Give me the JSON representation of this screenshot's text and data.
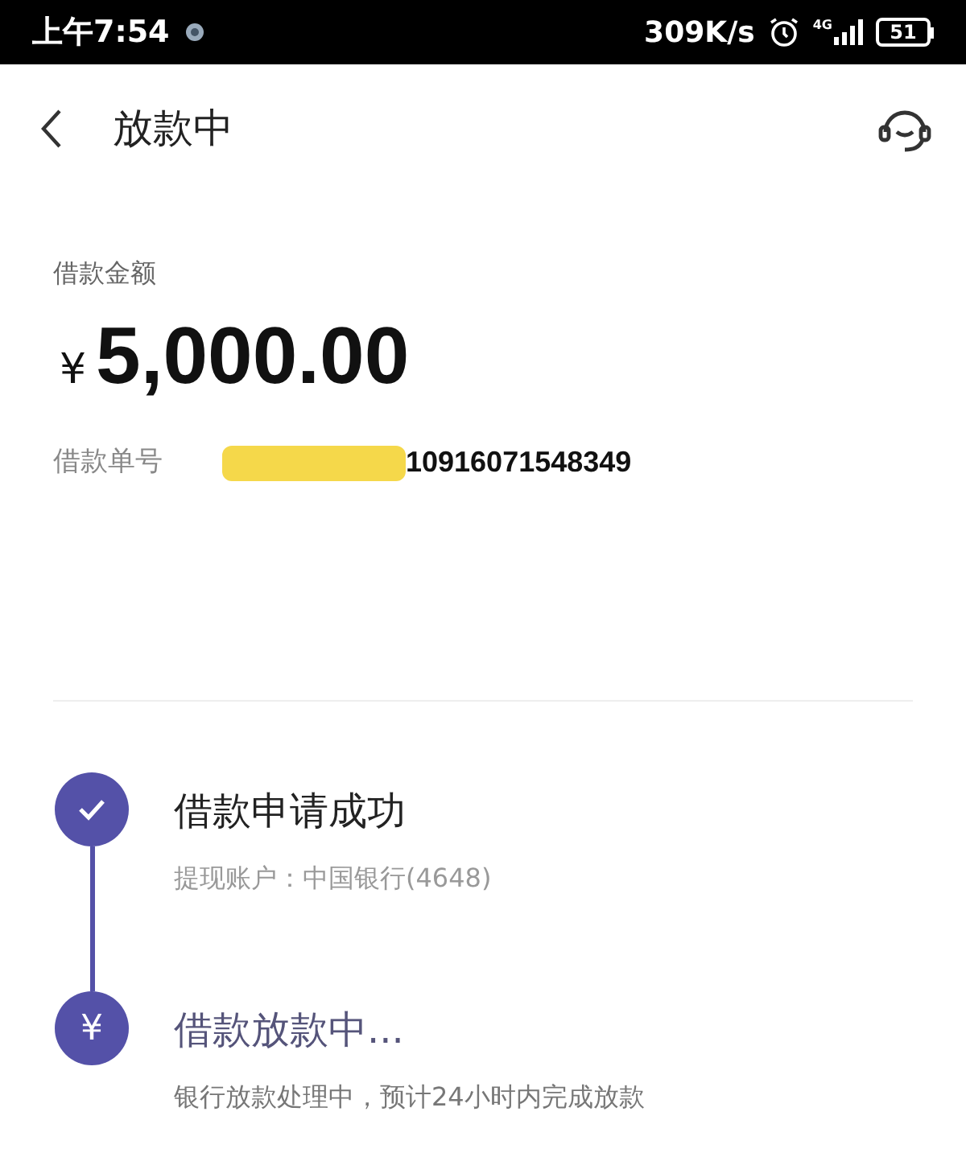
{
  "status_bar": {
    "time": "上午7:54",
    "speed": "309K/s",
    "network": "4G",
    "battery": "51"
  },
  "header": {
    "title": "放款中"
  },
  "loan": {
    "amount_label": "借款金额",
    "currency": "¥",
    "amount": "5,000.00",
    "number_label": "借款单号",
    "number": "10916071548349",
    "number_redacted": true
  },
  "steps": [
    {
      "kind": "done",
      "title": "借款申请成功",
      "detail": "提现账户：中国银行(4648)"
    },
    {
      "kind": "current",
      "icon_text": "¥",
      "title": "借款放款中...",
      "detail": "银行放款处理中，预计24小时内完成放款"
    }
  ]
}
